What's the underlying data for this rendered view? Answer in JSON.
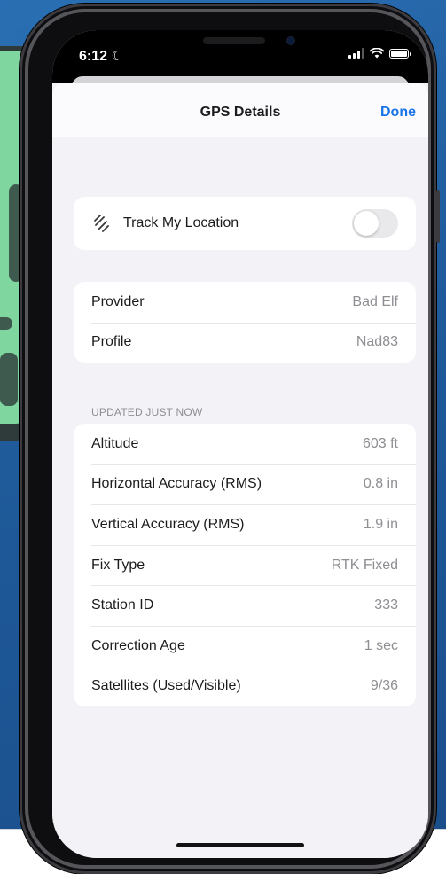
{
  "status_bar": {
    "time": "6:12",
    "moon": "☾"
  },
  "nav": {
    "title": "GPS Details",
    "done_label": "Done"
  },
  "track": {
    "label": "Track My Location",
    "enabled": false
  },
  "source_rows": [
    {
      "label": "Provider",
      "value": "Bad Elf"
    },
    {
      "label": "Profile",
      "value": "Nad83"
    }
  ],
  "section_header": "UPDATED JUST NOW",
  "detail_rows": [
    {
      "label": "Altitude",
      "value": "603 ft"
    },
    {
      "label": "Horizontal Accuracy (RMS)",
      "value": "0.8 in"
    },
    {
      "label": "Vertical Accuracy (RMS)",
      "value": "1.9 in"
    },
    {
      "label": "Fix Type",
      "value": "RTK Fixed"
    },
    {
      "label": "Station ID",
      "value": "333"
    },
    {
      "label": "Correction Age",
      "value": "1 sec"
    },
    {
      "label": "Satellites (Used/Visible)",
      "value": "9/36"
    }
  ],
  "colors": {
    "accent": "#1a73e8",
    "background": "#f2f2f7",
    "value_text": "#8e8e93"
  }
}
